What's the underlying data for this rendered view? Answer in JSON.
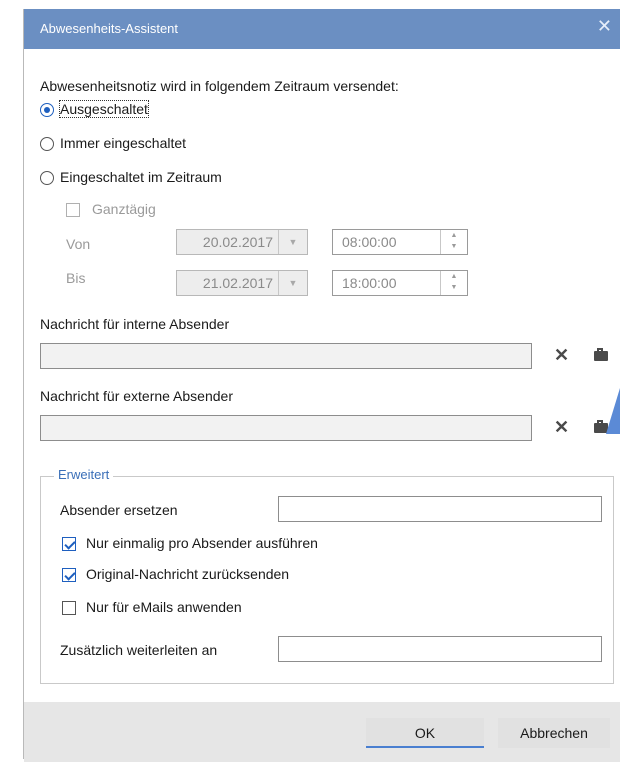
{
  "window": {
    "title": "Abwesenheits-Assistent",
    "close_glyph": "✕"
  },
  "period": {
    "heading": "Abwesenheitsnotiz wird in folgendem Zeitraum versendet:",
    "options": [
      {
        "label": "Ausgeschaltet",
        "selected": true
      },
      {
        "label": "Immer eingeschaltet",
        "selected": false
      },
      {
        "label": "Eingeschaltet im Zeitraum",
        "selected": false
      }
    ],
    "all_day_label": "Ganztägig",
    "from_label": "Von",
    "to_label": "Bis",
    "from_date": "20.02.2017",
    "from_time": "08:00:00",
    "to_date": "21.02.2017",
    "to_time": "18:00:00"
  },
  "messages": {
    "internal_label": "Nachricht für interne Absender",
    "internal_value": "",
    "external_label": "Nachricht für externe Absender",
    "external_value": ""
  },
  "advanced": {
    "legend": "Erweitert",
    "replace_sender_label": "Absender ersetzen",
    "replace_sender_value": "",
    "once_per_sender_label": "Nur einmalig pro Absender ausführen",
    "once_per_sender_checked": true,
    "return_original_label": "Original-Nachricht zurücksenden",
    "return_original_checked": true,
    "emails_only_label": "Nur für eMails anwenden",
    "emails_only_checked": false,
    "forward_label": "Zusätzlich weiterleiten an",
    "forward_value": ""
  },
  "buttons": {
    "ok": "OK",
    "cancel": "Abbrechen"
  },
  "icons": {
    "clear": "close-icon",
    "briefcase": "briefcase-icon",
    "dropdown": "chevron-down-icon",
    "spin": "spin-arrows-icon"
  },
  "colors": {
    "titlebar": "#6b8fc2",
    "accent": "#1e5fbf",
    "legend": "#3a6fb8"
  }
}
